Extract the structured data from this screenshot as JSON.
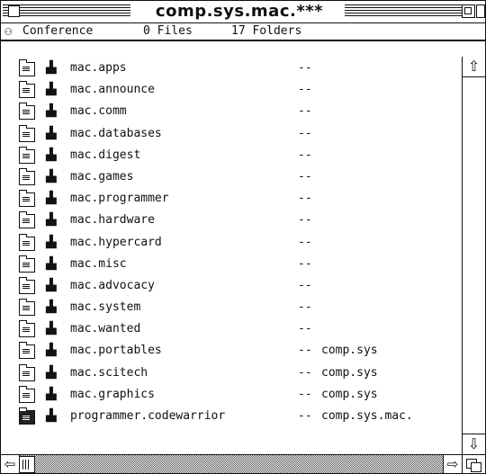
{
  "window": {
    "title": "comp.sys.mac.***"
  },
  "infobar": {
    "icon": "conference-icon",
    "type_label": "Conference",
    "files_label": "0 Files",
    "folders_label": "17 Folders"
  },
  "rows": [
    {
      "name": "mac.apps",
      "dash": "--",
      "group": ""
    },
    {
      "name": "mac.announce",
      "dash": "--",
      "group": ""
    },
    {
      "name": "mac.comm",
      "dash": "--",
      "group": ""
    },
    {
      "name": "mac.databases",
      "dash": "--",
      "group": ""
    },
    {
      "name": "mac.digest",
      "dash": "--",
      "group": ""
    },
    {
      "name": "mac.games",
      "dash": "--",
      "group": ""
    },
    {
      "name": "mac.programmer",
      "dash": "--",
      "group": ""
    },
    {
      "name": "mac.hardware",
      "dash": "--",
      "group": ""
    },
    {
      "name": "mac.hypercard",
      "dash": "--",
      "group": ""
    },
    {
      "name": "mac.misc",
      "dash": "--",
      "group": ""
    },
    {
      "name": "mac.advocacy",
      "dash": "--",
      "group": ""
    },
    {
      "name": "mac.system",
      "dash": "--",
      "group": ""
    },
    {
      "name": "mac.wanted",
      "dash": "--",
      "group": ""
    },
    {
      "name": "mac.portables",
      "dash": "--",
      "group": "comp.sys"
    },
    {
      "name": "mac.scitech",
      "dash": "--",
      "group": "comp.sys"
    },
    {
      "name": "mac.graphics",
      "dash": "--",
      "group": "comp.sys"
    },
    {
      "name": "programmer.codewarrior",
      "dash": "--",
      "group": "comp.sys.mac."
    }
  ]
}
